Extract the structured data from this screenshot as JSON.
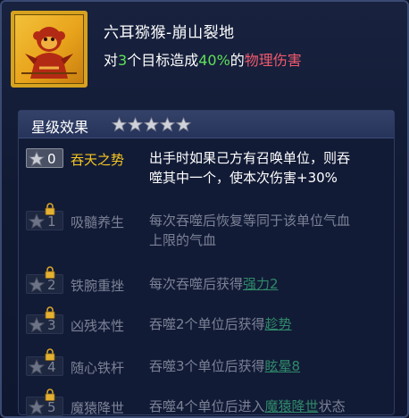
{
  "skill": {
    "name": "六耳猕猴-崩山裂地",
    "desc_part1": "对",
    "desc_targets": "3",
    "desc_part2": "个目标造成",
    "desc_percent": "40%",
    "desc_part3": "的",
    "desc_damage_type": "物理伤害",
    "colors": {
      "highlight": "#5fe05a",
      "damage": "#f05a6e",
      "icon_frame": "#d6a21f"
    },
    "icon": "monkey-warrior-icon"
  },
  "star_section": {
    "title": "星级效果",
    "stars_count": 5,
    "rows": [
      {
        "level": "0",
        "name": "吞天之势",
        "desc_line1": "出手时如果己方有召唤单位，则吞",
        "desc_line2": "噬其中一个，使本次伤害+30%",
        "locked": false
      },
      {
        "level": "1",
        "name": "吸髓养生",
        "desc_line1": "每次吞噬后恢复等同于该单位气血",
        "desc_line2": "上限的气血",
        "locked": true
      },
      {
        "level": "2",
        "name": "铁腕重挫",
        "desc_prefix": "每次吞噬后获得",
        "desc_link": "强力2",
        "locked": true
      },
      {
        "level": "3",
        "name": "凶残本性",
        "desc_prefix": "吞噬2个单位后获得",
        "desc_link": "趁势",
        "locked": true
      },
      {
        "level": "4",
        "name": "随心铁杆",
        "desc_prefix": "吞噬3个单位后获得",
        "desc_link": "眩晕8",
        "locked": true
      },
      {
        "level": "5",
        "name": "魔猿降世",
        "desc_prefix": "吞噬4个单位后进入",
        "desc_link": "魔猿降世",
        "desc_suffix": "状态",
        "locked": true
      }
    ]
  }
}
